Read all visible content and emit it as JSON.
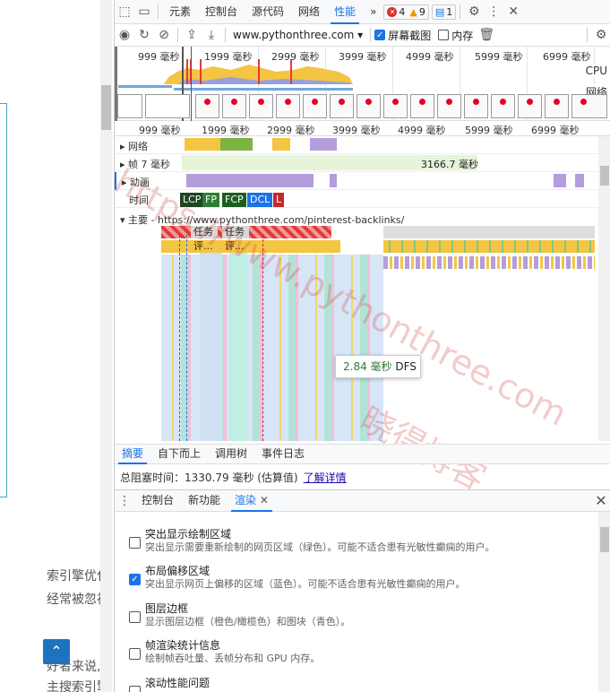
{
  "page": {
    "lines": [
      "索引擎优化",
      "经常被忽视",
      "好者来说,",
      "主搜索引擎"
    ]
  },
  "devtools": {
    "tabs": [
      "元素",
      "控制台",
      "源代码",
      "网络",
      "性能"
    ],
    "active_tab": "性能",
    "more": "»",
    "errors": "4",
    "warnings": "9",
    "messages": "1",
    "url": "www.pythonthree.com",
    "screenshots_label": "屏幕截图",
    "memory_label": "内存",
    "overview_ticks": [
      "999 毫秒",
      "1999 毫秒",
      "2999 毫秒",
      "3999 毫秒",
      "4999 毫秒",
      "5999 毫秒",
      "6999 毫秒"
    ],
    "ruler_ticks": [
      "999 毫秒",
      "1999 毫秒",
      "2999 毫秒",
      "3999 毫秒",
      "4999 毫秒",
      "5999 毫秒",
      "6999 毫秒"
    ],
    "cpu_label": "CPU",
    "net_label": "网络",
    "tracks": {
      "network": "网络",
      "frames": "帧 7 毫秒",
      "frames_value": "3166.7 毫秒",
      "animation": "动画",
      "timings": "时间",
      "main": "主要 - https://www.pythonthree.com/pinterest-backlinks/"
    },
    "timing_markers": [
      {
        "label": "LCP",
        "color": "#1e4620"
      },
      {
        "label": "FP",
        "color": "#2e7d32"
      },
      {
        "label": "FCP",
        "color": "#1b5e20"
      },
      {
        "label": "DCL",
        "color": "#1a73e8"
      },
      {
        "label": "L",
        "color": "#c62828"
      }
    ],
    "flame_labels": {
      "task1": "任务",
      "task2": "任务",
      "eval1": "评...",
      "eval2": "评..."
    },
    "tooltip": {
      "time": "2.84 毫秒",
      "name": "DFS"
    },
    "summary_tabs": [
      "摘要",
      "自下而上",
      "调用树",
      "事件日志"
    ],
    "blocking_text": "总阻塞时间：1330.79 毫秒 (估算值)",
    "learn_more": "了解详情",
    "drawer_tabs": [
      "控制台",
      "新功能",
      "渲染"
    ],
    "drawer_active": "渲染",
    "render_options": [
      {
        "title": "突出显示绘制区域",
        "desc": "突出显示需要重新绘制的网页区域（绿色）。可能不适合患有光敏性癫痫的用户。",
        "checked": false
      },
      {
        "title": "布局偏移区域",
        "desc": "突出显示网页上偏移的区域（蓝色）。可能不适合患有光敏性癫痫的用户。",
        "checked": true
      },
      {
        "title": "图层边框",
        "desc": "显示图层边框（橙色/橄榄色）和图块（青色）。",
        "checked": false
      },
      {
        "title": "帧渲染统计信息",
        "desc": "绘制帧吞吐量、丢帧分布和 GPU 内存。",
        "checked": false
      },
      {
        "title": "滚动性能问题",
        "desc": "",
        "checked": false
      }
    ],
    "watermark": [
      "https://www.pythonthree.com",
      "晓得博客"
    ]
  }
}
